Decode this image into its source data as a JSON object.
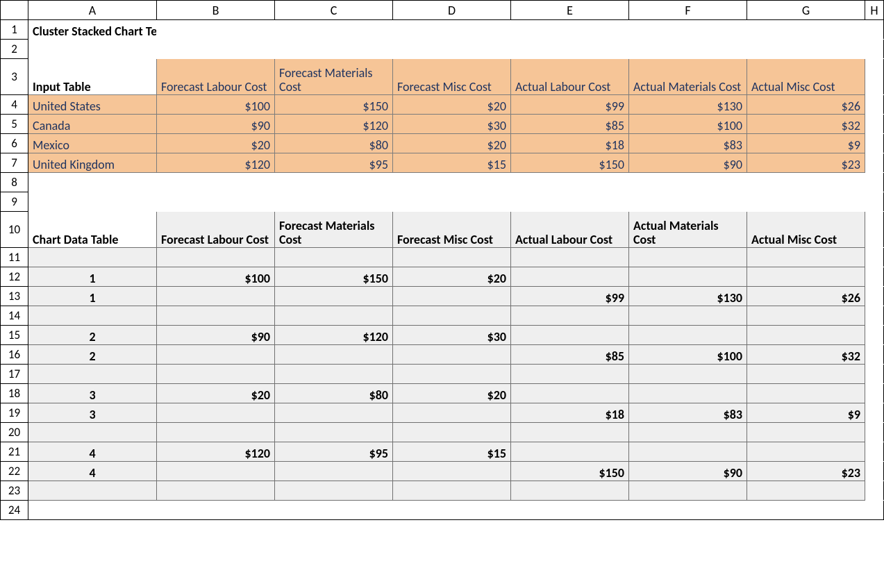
{
  "columns": [
    "A",
    "B",
    "C",
    "D",
    "E",
    "F",
    "G",
    "H"
  ],
  "rows": [
    "1",
    "2",
    "3",
    "4",
    "5",
    "6",
    "7",
    "8",
    "9",
    "10",
    "11",
    "12",
    "13",
    "14",
    "15",
    "16",
    "17",
    "18",
    "19",
    "20",
    "21",
    "22",
    "23",
    "24"
  ],
  "title": "Cluster Stacked Chart Template",
  "input": {
    "label": "Input Table",
    "headers": [
      "Forecast Labour Cost",
      "Forecast Materials Cost",
      "Forecast Misc Cost",
      "Actual Labour Cost",
      "Actual Materials Cost",
      "Actual Misc Cost"
    ],
    "rows": [
      {
        "name": "United States",
        "vals": [
          "$100",
          "$150",
          "$20",
          "$99",
          "$130",
          "$26"
        ]
      },
      {
        "name": "Canada",
        "vals": [
          "$90",
          "$120",
          "$30",
          "$85",
          "$100",
          "$32"
        ]
      },
      {
        "name": "Mexico",
        "vals": [
          "$20",
          "$80",
          "$20",
          "$18",
          "$83",
          "$9"
        ]
      },
      {
        "name": "United Kingdom",
        "vals": [
          "$120",
          "$95",
          "$15",
          "$150",
          "$90",
          "$23"
        ]
      }
    ]
  },
  "chart": {
    "label": "Chart Data Table",
    "headers": [
      "Forecast Labour Cost",
      "Forecast Materials Cost",
      "Forecast Misc Cost",
      "Actual Labour Cost",
      "Actual Materials Cost",
      "Actual Misc Cost"
    ],
    "rows": [
      {
        "idx": "",
        "vals": [
          "",
          "",
          "",
          "",
          "",
          ""
        ]
      },
      {
        "idx": "1",
        "vals": [
          "$100",
          "$150",
          "$20",
          "",
          "",
          ""
        ]
      },
      {
        "idx": "1",
        "vals": [
          "",
          "",
          "",
          "$99",
          "$130",
          "$26"
        ]
      },
      {
        "idx": "",
        "vals": [
          "",
          "",
          "",
          "",
          "",
          ""
        ]
      },
      {
        "idx": "2",
        "vals": [
          "$90",
          "$120",
          "$30",
          "",
          "",
          ""
        ]
      },
      {
        "idx": "2",
        "vals": [
          "",
          "",
          "",
          "$85",
          "$100",
          "$32"
        ]
      },
      {
        "idx": "",
        "vals": [
          "",
          "",
          "",
          "",
          "",
          ""
        ]
      },
      {
        "idx": "3",
        "vals": [
          "$20",
          "$80",
          "$20",
          "",
          "",
          ""
        ]
      },
      {
        "idx": "3",
        "vals": [
          "",
          "",
          "",
          "$18",
          "$83",
          "$9"
        ]
      },
      {
        "idx": "",
        "vals": [
          "",
          "",
          "",
          "",
          "",
          ""
        ]
      },
      {
        "idx": "4",
        "vals": [
          "$120",
          "$95",
          "$15",
          "",
          "",
          ""
        ]
      },
      {
        "idx": "4",
        "vals": [
          "",
          "",
          "",
          "$150",
          "$90",
          "$23"
        ]
      },
      {
        "idx": "",
        "vals": [
          "",
          "",
          "",
          "",
          "",
          ""
        ]
      }
    ]
  }
}
